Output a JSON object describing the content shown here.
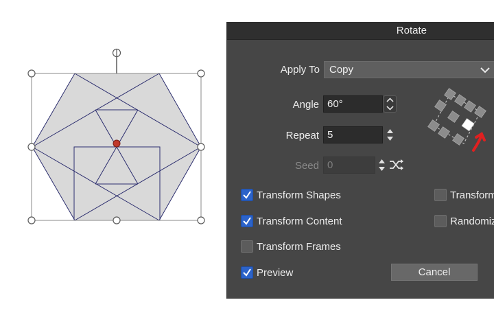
{
  "dialog": {
    "title": "Rotate",
    "apply_to": {
      "label": "Apply To",
      "value": "Copy"
    },
    "angle": {
      "label": "Angle",
      "value": "60°"
    },
    "repeat": {
      "label": "Repeat",
      "value": "5"
    },
    "seed": {
      "label": "Seed",
      "value": "0"
    },
    "checkboxes": [
      {
        "label": "Transform Shapes",
        "checked": true
      },
      {
        "label": "Transform Content",
        "checked": true
      },
      {
        "label": "Transform Frames",
        "checked": false
      },
      {
        "label": "Preview",
        "checked": true
      },
      {
        "label": "Transform",
        "checked": false
      },
      {
        "label": "Randomiz",
        "checked": false
      }
    ],
    "cancel_label": "Cancel"
  },
  "icons": {
    "dropdown": "chevron-down-icon",
    "stepper": "stepper-arrows-icon",
    "shuffle": "shuffle-icon",
    "rotation_preview": "rotation-pattern-icon",
    "checkmark": "checkmark-icon",
    "annotation": "red-arrow-icon"
  },
  "colors": {
    "dialog_bg": "#464646",
    "titlebar_bg": "#2f2f2f",
    "checkbox_on": "#2c63c9",
    "shape_fill": "#d9d9d9",
    "shape_stroke": "#2b2d6e",
    "selection_handle": "#5a5a5a",
    "center_point": "#c0392b",
    "annotation": "#e02020"
  }
}
